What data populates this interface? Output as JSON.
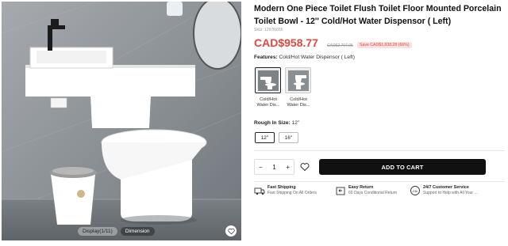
{
  "gallery": {
    "tabs": [
      "Display(1/11)",
      "Dimension"
    ]
  },
  "product": {
    "title": "Modern One Piece Toilet Flush Toilet Floor Mounted Porcelain Toilet Bowl - 12'' Cold/Hot Water Dispensor ( Left)",
    "sku": "SKU: 1297l6655",
    "price": "CAD$958.77",
    "old_price": "CAD$2,797.05",
    "save": "Save CAD$1,838.28 (66%)"
  },
  "features": {
    "label": "Features:",
    "value": "Cold/Hot Water Dispensor ( Left)",
    "options": [
      "Cold/Hot Water Dis...",
      "Cold/Hot Water Dis..."
    ]
  },
  "rough_size": {
    "label": "Rough In Size:",
    "value": "12''",
    "options": [
      "12''",
      "16''"
    ]
  },
  "cart": {
    "minus": "−",
    "quantity": "1",
    "plus": "+",
    "add_label": "ADD TO CART"
  },
  "benefits": [
    {
      "title": "Fast Shipping",
      "desc": "Fast Shipping On All Orders",
      "icon": "truck-icon"
    },
    {
      "title": "Easy Return",
      "desc": "60 Days Conditional Return",
      "icon": "return-icon"
    },
    {
      "title": "24/7 Customer Service",
      "desc": "Support to Help with All Your ...",
      "icon": "support-icon"
    }
  ]
}
